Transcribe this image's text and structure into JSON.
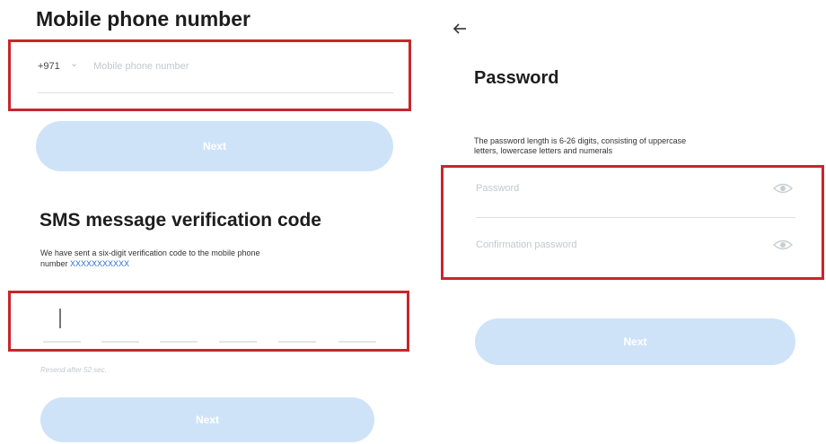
{
  "left": {
    "phone_title": "Mobile phone number",
    "country_code": "+971",
    "phone_placeholder": "Mobile phone number",
    "next_button_1": "Next",
    "sms_title": "SMS message verification code",
    "sms_desc_1": "We have sent a six-digit verification code to the mobile phone",
    "sms_desc_2_prefix": "number",
    "masked_number": "XXXXXXXXXXX",
    "resend_text": "Resend after 52 sec.",
    "next_button_2": "Next"
  },
  "right": {
    "back_icon": "arrow-left-icon",
    "password_title": "Password",
    "password_desc_1": "The password length is 6-26 digits, consisting of uppercase",
    "password_desc_2": "letters, lowercase letters and numerals",
    "password_placeholder": "Password",
    "confirm_placeholder": "Confirmation password",
    "next_button": "Next"
  },
  "colors": {
    "highlight": "#c8262c",
    "button_bg": "#cfe3f8",
    "link": "#2f6fd6"
  }
}
